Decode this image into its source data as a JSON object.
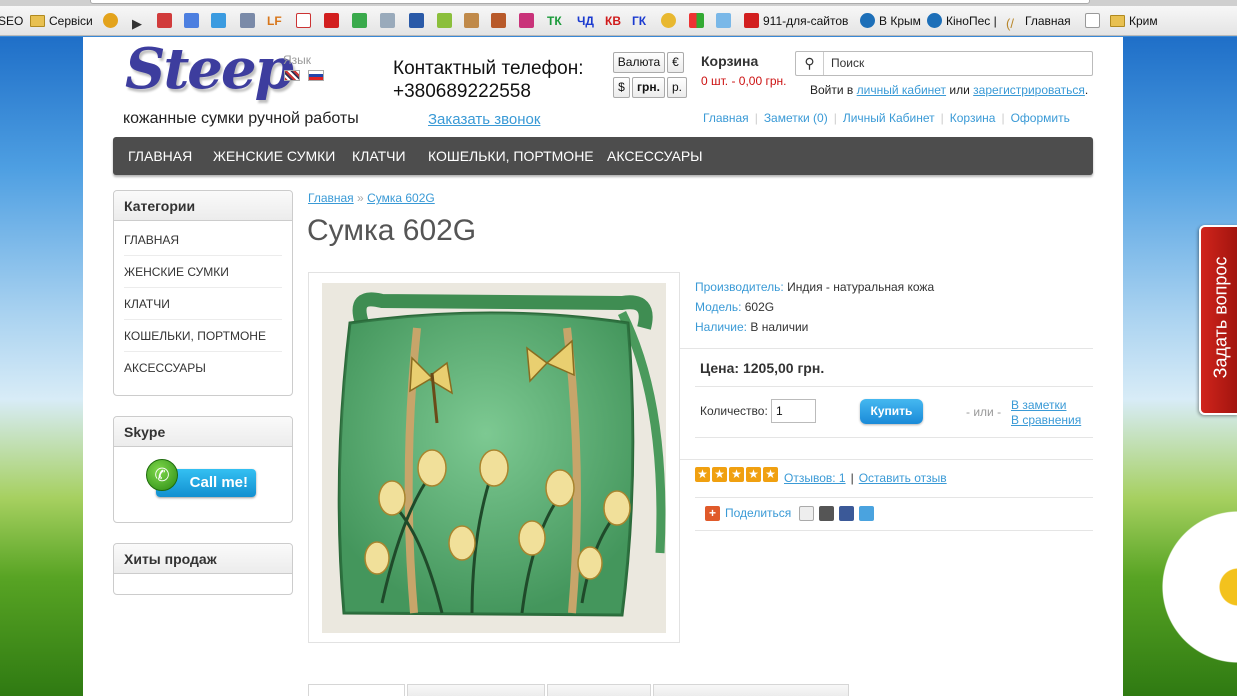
{
  "bookmarks": {
    "items": [
      {
        "label": "SEO",
        "icon": "folder-icon"
      },
      {
        "label": "Сервіси",
        "icon": "folder-icon"
      },
      {
        "label": "911-для-сайтов",
        "icon": "site-icon"
      },
      {
        "label": "В Крым",
        "icon": "drupal-icon"
      },
      {
        "label": "КіноПес |",
        "icon": "drupal-icon"
      },
      {
        "label": "Главная",
        "icon": "site-icon"
      },
      {
        "label": "Крим",
        "icon": "folder-icon"
      }
    ]
  },
  "header": {
    "logo": "Steep",
    "tagline": "кожанные сумки ручной работы",
    "language_label": "Язык",
    "phone_label": "Контактный телефон:",
    "phone": "+380689222558",
    "callback": "Заказать звонок",
    "currency": {
      "label": "Валюта",
      "eur": "€",
      "usd": "$",
      "uah": "грн.",
      "rub": "р."
    },
    "cart": {
      "title": "Корзина",
      "summary": "0 шт. - 0,00 грн."
    },
    "search_placeholder": "Поиск",
    "login": {
      "prefix": "Войти в",
      "cabinet": "личный кабинет",
      "or": "или",
      "register": "зарегистрироваться",
      "suffix": "."
    },
    "top_links": [
      "Главная",
      "Заметки (0)",
      "Личный Кабинет",
      "Корзина",
      "Оформить"
    ]
  },
  "menu": [
    "ГЛАВНАЯ",
    "ЖЕНСКИЕ СУМКИ",
    "КЛАТЧИ",
    "КОШЕЛЬКИ, ПОРТМОНЕ",
    "АКСЕССУАРЫ"
  ],
  "sidebar": {
    "categories_title": "Категории",
    "categories": [
      "ГЛАВНАЯ",
      "ЖЕНСКИЕ СУМКИ",
      "КЛАТЧИ",
      "КОШЕЛЬКИ, ПОРТМОНЕ",
      "АКСЕССУАРЫ"
    ],
    "skype_title": "Skype",
    "skype_button": "Call me!",
    "hits_title": "Хиты продаж"
  },
  "product": {
    "breadcrumb": [
      "Главная",
      "Сумка 602G"
    ],
    "breadcrumb_sep": "»",
    "title": "Сумка 602G",
    "manufacturer_label": "Производитель:",
    "manufacturer": "Индия - натуральная кожа",
    "model_label": "Модель:",
    "model": "602G",
    "availability_label": "Наличие:",
    "availability": "В наличии",
    "price": "Цена: 1205,00 грн.",
    "qty_label": "Количество:",
    "qty": "1",
    "buy": "Купить",
    "or": "- или -",
    "wishlist": "В заметки",
    "compare": "В сравнения",
    "rating": 5,
    "reviews": "Отзывов: 1",
    "review_sep": "|",
    "write_review": "Оставить отзыв",
    "share": "Поделиться"
  },
  "ask_question": "Задать вопрос"
}
